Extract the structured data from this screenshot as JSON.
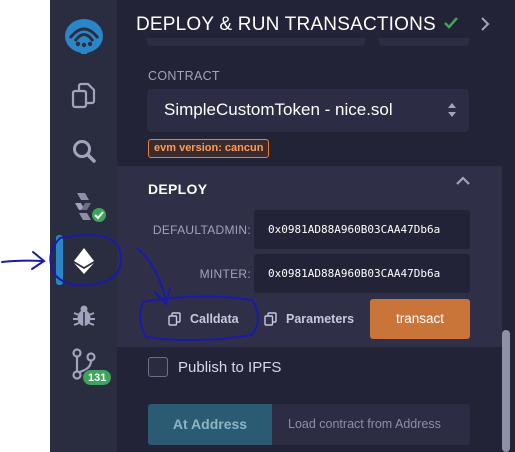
{
  "panel": {
    "title": "DEPLOY & RUN TRANSACTIONS",
    "contract_label": "CONTRACT",
    "contract_selected": "SimpleCustomToken - nice.sol",
    "evm_badge": "evm version: cancun",
    "deploy_title": "DEPLOY",
    "fields": [
      {
        "label": "DEFAULTADMIN:",
        "value": "0x0981AD88A960B03CAA47Db6a"
      },
      {
        "label": "MINTER:",
        "value": "0x0981AD88A960B03CAA47Db6a"
      }
    ],
    "calldata_label": "Calldata",
    "parameters_label": "Parameters",
    "transact_label": "transact",
    "publish_label": "Publish to IPFS",
    "at_address_label": "At Address",
    "load_contract_placeholder": "Load contract from Address"
  },
  "rail": {
    "git_badge_count": "131",
    "icons": [
      "remix-logo-icon",
      "file-explorer-icon",
      "search-icon",
      "solidity-compiler-icon",
      "deploy-run-icon",
      "debugger-icon",
      "git-icon"
    ]
  },
  "colors": {
    "rail_bg": "#2a2c3f",
    "panel_bg": "#222336",
    "section_bg": "#2f3047",
    "accent_orange": "#c9753a",
    "success_green": "#3fa45b",
    "annotation_ink": "#1a1aa8"
  }
}
